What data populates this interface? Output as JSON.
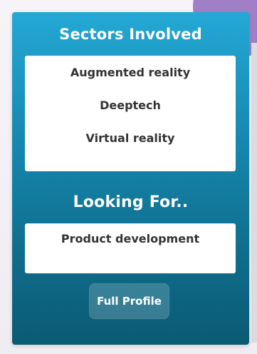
{
  "sectors": {
    "title": "Sectors Involved",
    "items": [
      "Augmented reality",
      "Deeptech",
      "Virtual reality"
    ]
  },
  "looking_for": {
    "title": "Looking For..",
    "items": [
      "Product development"
    ]
  },
  "actions": {
    "full_profile": "Full Profile"
  },
  "colors": {
    "card_gradient_top": "#24a8d5",
    "card_gradient_bottom": "#0b5a73",
    "accent_circle": "#a07fc6",
    "box_background": "#ffffff",
    "item_text": "#333333"
  }
}
